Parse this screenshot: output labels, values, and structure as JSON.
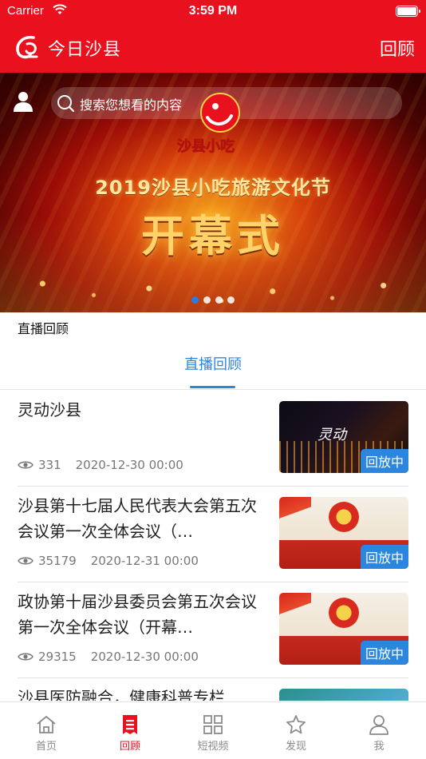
{
  "status_bar": {
    "carrier": "Carrier",
    "time": "3:59 PM"
  },
  "nav": {
    "title": "今日沙县",
    "right_link": "回顾"
  },
  "banner": {
    "search_placeholder": "搜索您想看的内容",
    "brand_text": "沙县小吃",
    "headline": "2019沙县小吃旅游文化节",
    "main_text": "开幕式",
    "active_dot": 0,
    "dot_count": 4
  },
  "section_label": "直播回顾",
  "tab": {
    "label": "直播回顾"
  },
  "list": [
    {
      "title": "灵动沙县",
      "views": "331",
      "date": "2020-12-30 00:00",
      "badge": "回放中",
      "thumb": "night"
    },
    {
      "title": "沙县第十七届人民代表大会第五次会议第一次全体会议（…",
      "views": "35179",
      "date": "2020-12-31 00:00",
      "badge": "回放中",
      "thumb": "meeting"
    },
    {
      "title": "政协第十届沙县委员会第五次会议第一次全体会议（开幕…",
      "views": "29315",
      "date": "2020-12-30 00:00",
      "badge": "回放中",
      "thumb": "meeting"
    },
    {
      "title": "沙县医防融合，健康科普专栏",
      "views": "",
      "date": "",
      "badge": "",
      "thumb": "green"
    }
  ],
  "tabbar": [
    {
      "label": "首页",
      "icon": "home-icon"
    },
    {
      "label": "回顾",
      "icon": "replay-icon",
      "active": true
    },
    {
      "label": "短视频",
      "icon": "grid-icon"
    },
    {
      "label": "发现",
      "icon": "star-icon"
    },
    {
      "label": "我",
      "icon": "user-icon"
    }
  ],
  "colors": {
    "brand_red": "#e8111d",
    "accent_blue": "#2c86e0"
  }
}
